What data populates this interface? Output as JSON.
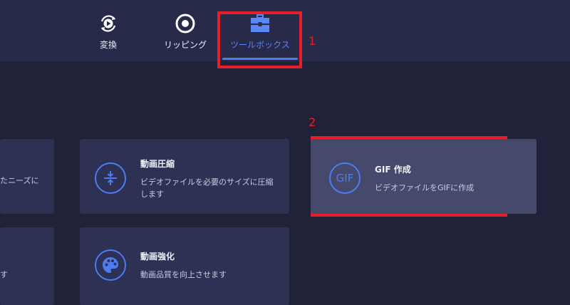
{
  "nav": {
    "tabs": [
      {
        "label": "変換",
        "icon": "play-circle-rotate-icon"
      },
      {
        "label": "リッピング",
        "icon": "disc-icon"
      },
      {
        "label": "ツールボックス",
        "icon": "toolbox-icon",
        "active": true
      }
    ]
  },
  "annotations": {
    "step1": "1",
    "step2": "2"
  },
  "tools": {
    "left_top_desc": "たニーズに",
    "left_bottom_desc": "す",
    "compress": {
      "title": "動画圧縮",
      "desc": "ビデオファイルを必要のサイズに圧縮します",
      "icon": "compress-icon"
    },
    "gif": {
      "title": "GIF 作成",
      "desc": "ビデオファイルをGIFに作成",
      "icon_text": "GIF",
      "icon": "gif-icon"
    },
    "enhance": {
      "title": "動画強化",
      "desc": "動画品質を向上させます",
      "icon": "palette-icon"
    }
  },
  "colors": {
    "accent": "#4f7bf2",
    "callout": "#e5202a",
    "background": "#1f2239",
    "card": "#2d3153"
  }
}
